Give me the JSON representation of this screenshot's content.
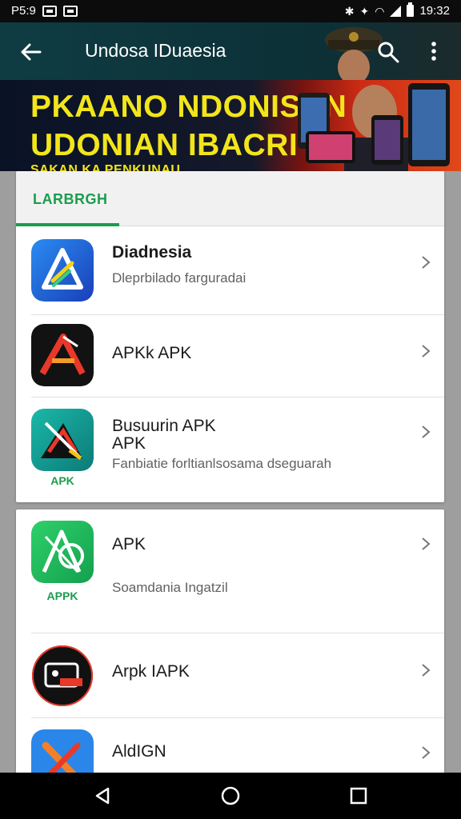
{
  "status_bar": {
    "left_text": "P5:9",
    "time": "19:32",
    "icons": [
      "screen-icon",
      "image-icon",
      "bluetooth-icon",
      "nfc-icon",
      "wifi-icon",
      "signal-icon",
      "battery-icon"
    ]
  },
  "app_bar": {
    "title": "Undosa IDuaesia",
    "icons": [
      "back-arrow-icon",
      "search-icon",
      "more-vert-icon"
    ]
  },
  "banner": {
    "line1": "PKAANO NDONISAN",
    "line2": "UDONIAN IBACRI",
    "line3": "SAKAN KA PENKUNAU"
  },
  "tabs": [
    {
      "label": "LARBRGH",
      "selected": true
    }
  ],
  "list_group_1": [
    {
      "title": "Diadnesia",
      "subtitle": "Dleprbilado farguradai",
      "icon": "blue-delta-app-icon"
    },
    {
      "title": "APKk APK",
      "subtitle": "",
      "icon": "red-a-app-icon"
    },
    {
      "title": "Busuurin APK",
      "title2": "APK",
      "subtitle": "Fanbiatie forltianlsosama dseguarah",
      "icon": "teal-x-app-icon",
      "icon_caption": "APK"
    }
  ],
  "list_group_2": [
    {
      "title": "APK",
      "subtitle": "Soamdania Ingatzil",
      "icon": "green-a-app-icon",
      "icon_caption": "APPK"
    },
    {
      "title": "Arpk IAPK",
      "subtitle": "",
      "icon": "black-camera-app-icon"
    },
    {
      "title": "AldIGN",
      "subtitle": "",
      "icon": "blue-x-app-icon"
    }
  ],
  "colors": {
    "app_bar": "#0f3c43",
    "accent_green": "#1a9d4e",
    "banner_text": "#f2e51a"
  },
  "nav_bar": {
    "icons": [
      "back-triangle-icon",
      "home-circle-icon",
      "recents-square-icon"
    ]
  }
}
